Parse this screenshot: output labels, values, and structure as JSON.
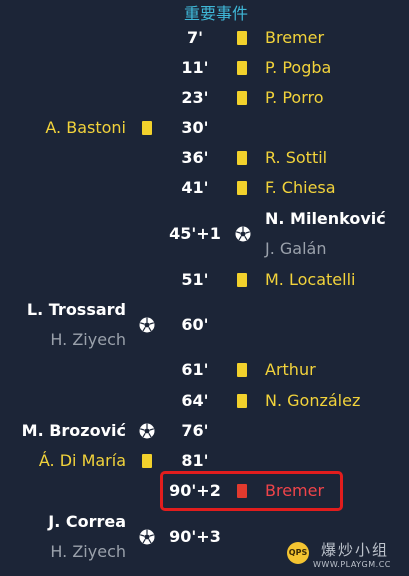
{
  "title": "重要事件",
  "events": [
    {
      "minute": "7'",
      "right": {
        "name": "Bremer",
        "icon": "yellow-card-icon"
      }
    },
    {
      "minute": "11'",
      "right": {
        "name": "P. Pogba",
        "icon": "yellow-card-icon"
      }
    },
    {
      "minute": "23'",
      "right": {
        "name": "P. Porro",
        "icon": "yellow-card-icon"
      }
    },
    {
      "minute": "30'",
      "left": {
        "name": "A. Bastoni",
        "icon": "yellow-card-icon"
      }
    },
    {
      "minute": "36'",
      "right": {
        "name": "R. Sottil",
        "icon": "yellow-card-icon"
      }
    },
    {
      "minute": "41'",
      "right": {
        "name": "F. Chiesa",
        "icon": "yellow-card-icon"
      }
    },
    {
      "minute": "45'+1",
      "right": {
        "scorer": "N. Milenković",
        "assist": "J. Galán",
        "icon": "soccer-ball-icon"
      }
    },
    {
      "minute": "51'",
      "right": {
        "name": "M. Locatelli",
        "icon": "yellow-card-icon"
      }
    },
    {
      "minute": "60'",
      "left": {
        "scorer": "L. Trossard",
        "assist": "H. Ziyech",
        "icon": "soccer-ball-icon"
      }
    },
    {
      "minute": "61'",
      "right": {
        "name": "Arthur",
        "icon": "yellow-card-icon"
      }
    },
    {
      "minute": "64'",
      "right": {
        "name": "N. González",
        "icon": "yellow-card-icon"
      }
    },
    {
      "minute": "76'",
      "left": {
        "scorer": "M. Brozović",
        "icon": "soccer-ball-icon"
      }
    },
    {
      "minute": "81'",
      "left": {
        "name": "Á. Di María",
        "icon": "yellow-card-icon"
      }
    },
    {
      "minute": "90'+2",
      "right": {
        "name": "Bremer",
        "icon": "red-card-icon"
      }
    },
    {
      "minute": "90'+3",
      "left": {
        "scorer": "J. Correa",
        "assist": "H. Ziyech",
        "icon": "soccer-ball-icon"
      }
    }
  ],
  "watermark": {
    "logo_text": "QPS",
    "text": "爆炒小组",
    "url": "WWW.PLAYGM.CC"
  },
  "colors": {
    "background": "#1c2537",
    "title": "#3fb8d8",
    "yellow_name": "#f2d33b",
    "red_name": "#f0444a",
    "assist_name": "#9aa1ab",
    "highlight_border": "#e11d1d"
  }
}
